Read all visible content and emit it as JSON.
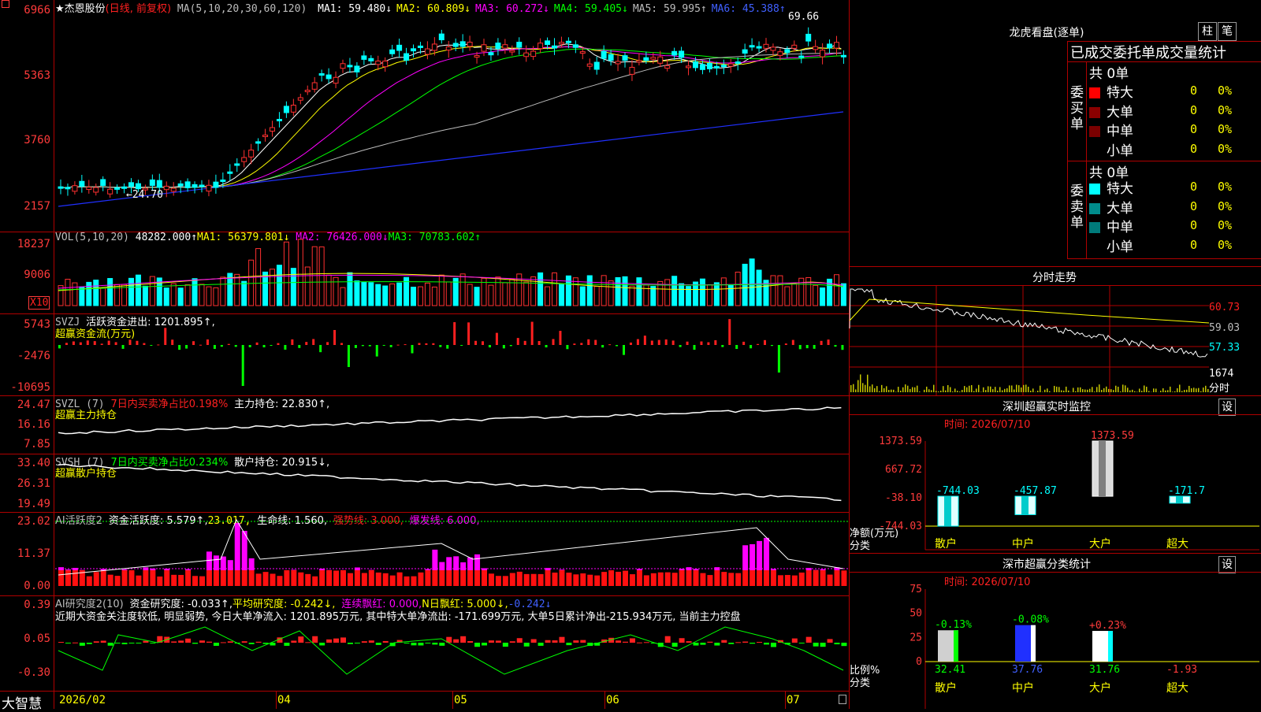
{
  "stock": {
    "marker": "★",
    "name": "杰恩股份",
    "mode": "(日线, 前复权)"
  },
  "main": {
    "ma_label": "MA(5,10,20,30,60,120)",
    "ma": [
      {
        "label": "MA1:",
        "value": "59.480↓",
        "color": "#ffffff"
      },
      {
        "label": "MA2:",
        "value": "60.809↓",
        "color": "#ffff00"
      },
      {
        "label": "MA3:",
        "value": "60.272↓",
        "color": "#ff00ff"
      },
      {
        "label": "MA4:",
        "value": "59.405↓",
        "color": "#00ff00"
      },
      {
        "label": "MA5:",
        "value": "59.995↑",
        "color": "#bdbdbd"
      },
      {
        "label": "MA6:",
        "value": "45.388↑",
        "color": "#4060ff"
      }
    ],
    "y_ticks": [
      "6966",
      "5363",
      "3760",
      "2157"
    ],
    "high_mark": "69.66",
    "low_mark": "←24.70"
  },
  "vol": {
    "title": "VOL(5,10,20)",
    "value": "48282.000↑",
    "ma1": "MA1: 56379.801↓",
    "ma2": "MA2: 76426.000↓",
    "ma3": "MA3: 70783.602↑",
    "y_ticks": [
      "18237",
      "9006"
    ],
    "x10": "X10"
  },
  "svzj": {
    "title": "SVZJ",
    "label": "活跃资金进出: 1201.895↑,",
    "sub": "超赢资金流(万元)",
    "y_ticks": [
      "5743",
      "-2476",
      "-10695"
    ]
  },
  "svzl": {
    "title": "SVZL (7)",
    "pct": "7日内买卖净占比0.198%",
    "label": "主力持仓: 22.830↑,",
    "sub": "超赢主力持仓",
    "y_ticks": [
      "24.47",
      "16.16",
      "7.85"
    ]
  },
  "svsh": {
    "title": "SVSH (7)",
    "pct": "7日内买卖净占比0.234%",
    "label": "散户持仓: 20.915↓,",
    "sub": "超赢散户持仓",
    "y_ticks": [
      "33.40",
      "26.31",
      "19.49"
    ]
  },
  "ai1": {
    "title": "AI活跃度2",
    "a": "资金活跃度: 5.579↑,",
    "b": "23.017,",
    "c": "生命线: 1.560,",
    "d": "强势线: 3.000,",
    "e": "爆发线: 6.000,",
    "y_ticks": [
      "23.02",
      "11.37",
      "0.00"
    ]
  },
  "ai2": {
    "title": "AI研究度2(10)",
    "a": "资金研究度: -0.033↑,",
    "b": "平均研究度: -0.242↓,",
    "c": "连续飘红: 0.000,",
    "d": "N日飘红: 5.000↓,",
    "e": "-0.242↓",
    "note": "近期大资金关注度较低, 明显弱势, 今日大单净流入: 1201.895万元, 其中特大单净流出: -171.699万元, 大单5日累计净出-215.934万元, 当前主力控盘",
    "y_ticks": [
      "0.39",
      "0.05",
      "-0.30"
    ]
  },
  "x_axis": {
    "app": "大智慧",
    "labels": [
      "2026/02",
      "04",
      "05",
      "06",
      "07"
    ]
  },
  "lhb": {
    "title": "龙虎看盘(逐单)",
    "btn1": "柱",
    "btn2": "笔",
    "header": "已成交委托单成交量统计",
    "buy_side": "委买单",
    "sell_side": "委卖单",
    "buy_total": "共 0单",
    "sell_total": "共 0单",
    "buy_rows": [
      {
        "label": "特大",
        "count": "0",
        "pct": "0%",
        "color": "#ff0000"
      },
      {
        "label": "大单",
        "count": "0",
        "pct": "0%",
        "color": "#8b0000"
      },
      {
        "label": "中单",
        "count": "0",
        "pct": "0%",
        "color": "#7a0000"
      },
      {
        "label": "小单",
        "count": "0",
        "pct": "0%",
        "color": "#000000"
      }
    ],
    "sell_rows": [
      {
        "label": "特大",
        "count": "0",
        "pct": "0%",
        "color": "#00ffff"
      },
      {
        "label": "大单",
        "count": "0",
        "pct": "0%",
        "color": "#008c8c"
      },
      {
        "label": "中单",
        "count": "0",
        "pct": "0%",
        "color": "#007a7a"
      },
      {
        "label": "小单",
        "count": "0",
        "pct": "0%",
        "color": "#000000"
      }
    ]
  },
  "intraday": {
    "title": "分时走势",
    "y_ticks": [
      "60.73",
      "59.03",
      "57.33"
    ],
    "vol_tick": "1674",
    "vol_label": "分时"
  },
  "monitor": {
    "title": "深圳超赢实时监控",
    "btn": "设",
    "time": "时间: 2026/07/10",
    "y_ticks": [
      "1373.59",
      "667.72",
      "-38.10",
      "-744.03"
    ],
    "side_label1": "净额(万元)",
    "side_label2": "分类",
    "cats": [
      "散户",
      "中户",
      "大户",
      "超大"
    ],
    "values_text": [
      "-744.03",
      "-457.87",
      "1373.59",
      "-171.7"
    ]
  },
  "classify": {
    "title": "深市超赢分类统计",
    "btn": "设",
    "time": "时间: 2026/07/10",
    "y_ticks": [
      "75",
      "50",
      "25",
      "0"
    ],
    "side_label1": "比例%",
    "side_label2": "分类",
    "cats": [
      "散户",
      "中户",
      "大户",
      "超大"
    ],
    "pct_text": [
      "-0.13%",
      "-0.08%",
      "+0.23%"
    ],
    "values_text": [
      "32.41",
      "37.76",
      "31.76",
      "-1.93"
    ]
  },
  "chart_data": [
    {
      "type": "bar",
      "title": "深圳超赢实时监控",
      "ylabel": "净额(万元)",
      "categories": [
        "散户",
        "中户",
        "大户",
        "超大"
      ],
      "values": [
        -744.03,
        -457.87,
        1373.59,
        -171.7
      ],
      "ylim": [
        -744.03,
        1373.59
      ]
    },
    {
      "type": "bar",
      "title": "深市超赢分类统计",
      "ylabel": "比例%",
      "categories": [
        "散户",
        "中户",
        "大户",
        "超大"
      ],
      "values": [
        32.41,
        37.76,
        31.76,
        -1.93
      ],
      "ylim": [
        0,
        75
      ]
    }
  ]
}
